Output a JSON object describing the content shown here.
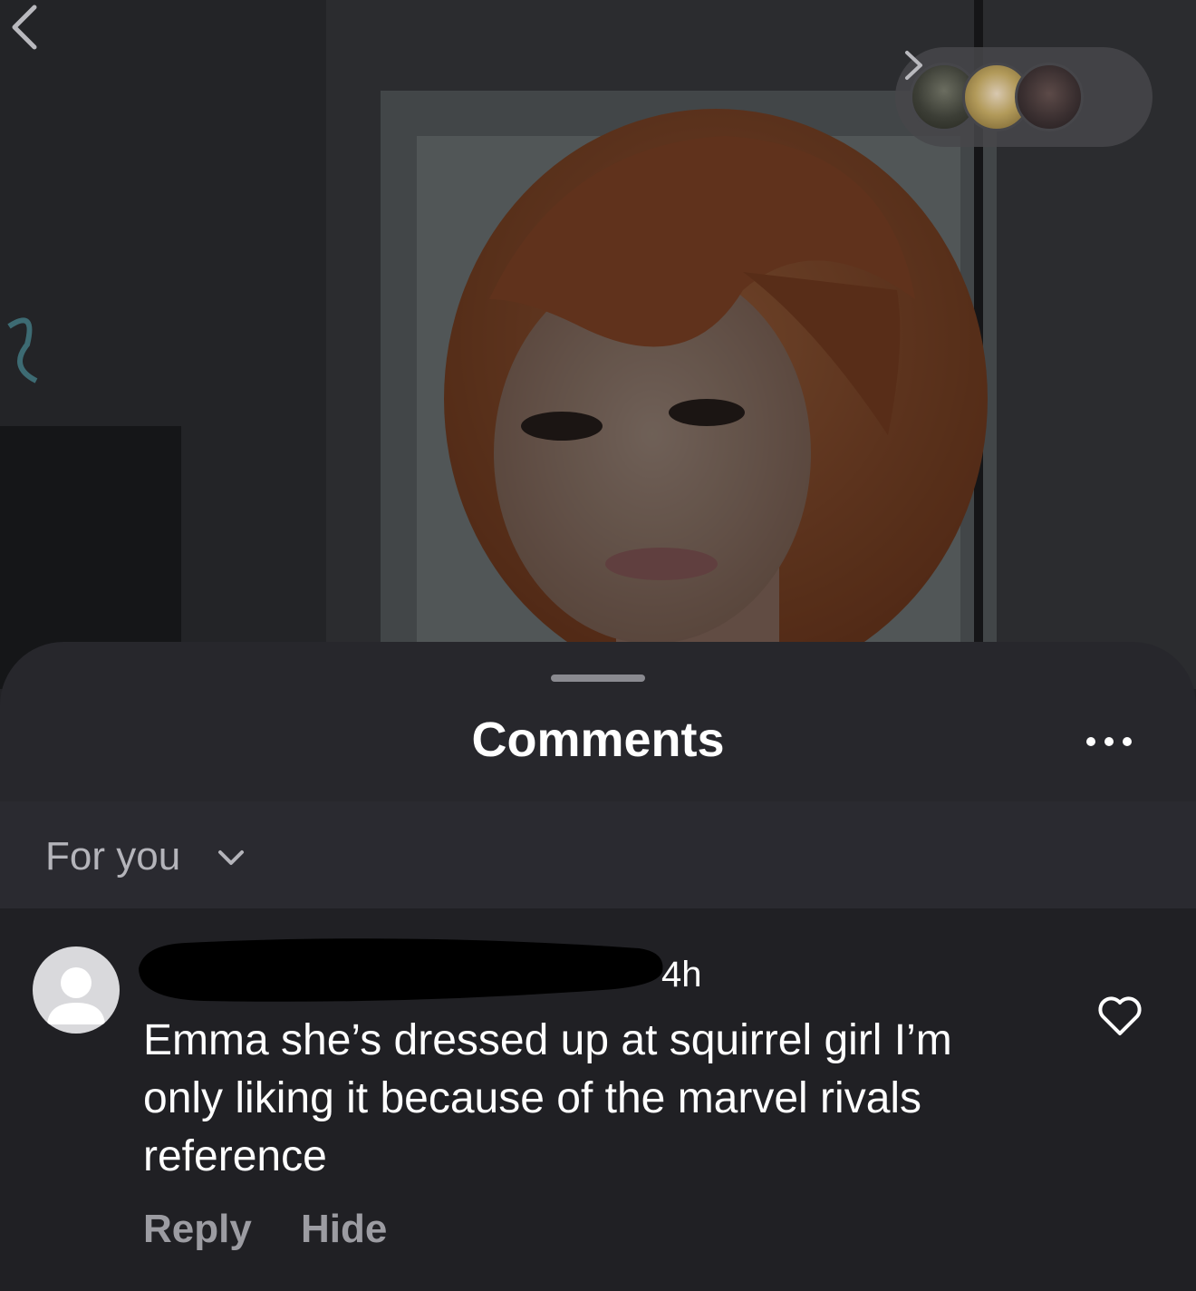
{
  "story": {
    "back_icon": "chevron-left-icon",
    "viewers_next_icon": "chevron-right-icon"
  },
  "sheet": {
    "title": "Comments",
    "more_icon": "ellipsis-icon"
  },
  "filter": {
    "label": "For you",
    "icon": "chevron-down-icon"
  },
  "comment": {
    "time": "4h",
    "text": "Emma she’s dressed up at squirrel girl I’m only liking it because of the marvel rivals reference",
    "reply_label": "Reply",
    "hide_label": "Hide",
    "like_icon": "heart-icon"
  },
  "colors": {
    "sheet_bg": "#27272c",
    "comment_bg": "#202024",
    "muted_text": "#9c9ca2",
    "hair": "#c86a3c"
  }
}
